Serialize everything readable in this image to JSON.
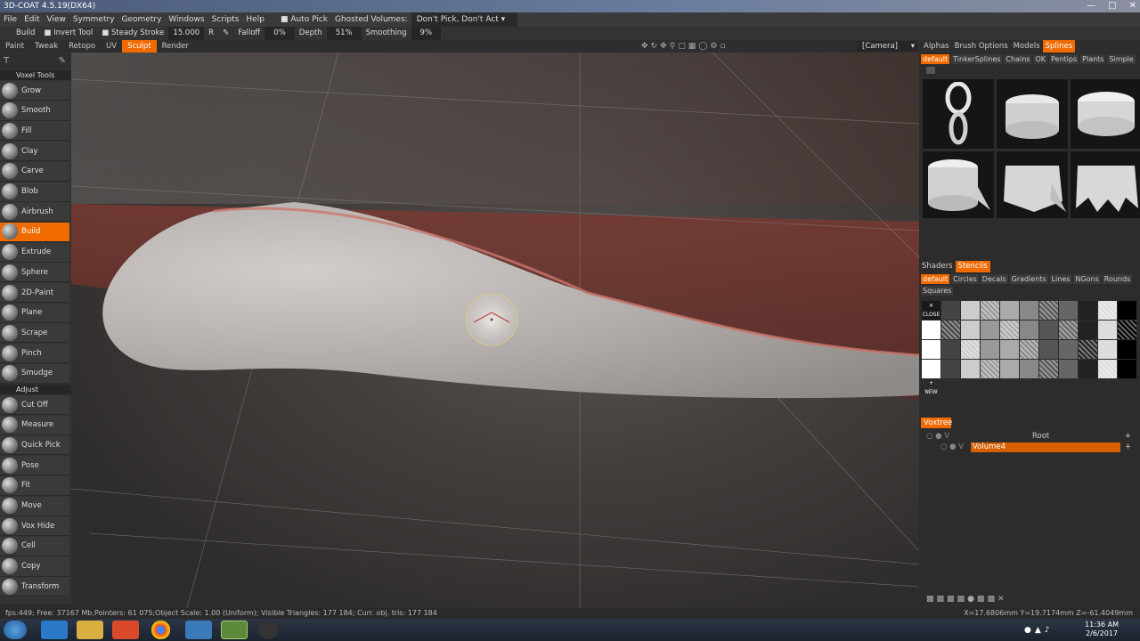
{
  "window": {
    "title": "3D-COAT 4.5.19(DX64)"
  },
  "menu": [
    "File",
    "Edit",
    "View",
    "Symmetry",
    "Geometry",
    "Windows",
    "Scripts",
    "Help"
  ],
  "autopick": {
    "label": "Auto Pick",
    "ghosted_label": "Ghosted Volumes:",
    "ghosted_value": "Don't Pick, Don't Act"
  },
  "tool_options": {
    "build": "Build",
    "invert": "Invert Tool",
    "steady": "Steady Stroke",
    "steady_value": "15.000",
    "r": "R",
    "falloff": "Falloff",
    "falloff_value": "0%",
    "depth": "Depth",
    "depth_value": "51%",
    "smoothing": "Smoothing",
    "smoothing_value": "9%"
  },
  "rooms": [
    "Paint",
    "Tweak",
    "Retopo",
    "UV",
    "Sculpt",
    "Render"
  ],
  "active_room": "Sculpt",
  "camera": "[Camera]",
  "right_tabs": [
    "Alphas",
    "Brush Options",
    "Models",
    "Splines"
  ],
  "spline_subtabs": [
    "default",
    "TinkerSplines",
    "Chains",
    "OK",
    "Pentips",
    "Plants",
    "Simple"
  ],
  "stencil_tabs": [
    "Shaders",
    "Stencils"
  ],
  "stencil_subtabs": [
    "default",
    "Circles",
    "Decals",
    "Gradients",
    "Lines",
    "NGons",
    "Rounds",
    "Squares"
  ],
  "stencil_close": "CLOSE",
  "stencil_new": "NEW",
  "voxtree": {
    "tab": "Voxtree",
    "root": "Root",
    "volume": "Volume4"
  },
  "sections": {
    "voxel": "Voxel Tools",
    "adjust": "Adjust"
  },
  "voxel_tools": [
    "Grow",
    "Smooth",
    "Fill",
    "Clay",
    "Carve",
    "Blob",
    "Airbrush",
    "Build",
    "Extrude",
    "Sphere",
    "2D-Paint",
    "Plane",
    "Scrape",
    "Pinch",
    "Smudge"
  ],
  "adjust_tools": [
    "Cut Off",
    "Measure",
    "Quick Pick",
    "Pose",
    "Fit",
    "Move",
    "Vox Hide",
    "Cell",
    "Copy",
    "Transform"
  ],
  "active_tool": "Build",
  "status": {
    "left": "fps:449;   Free: 37167 Mb,Pointers: 61 075;Object Scale: 1.00 (Uniform); Visible Triangles: 177 184; Curr. obj. tris: 177 184",
    "coords": "X=17.6806mm  Y=19.7174mm  Z=-61.4049mm"
  },
  "clock": {
    "time": "11:36 AM",
    "date": "2/6/2017"
  },
  "colors": {
    "accent": "#f06a00"
  }
}
